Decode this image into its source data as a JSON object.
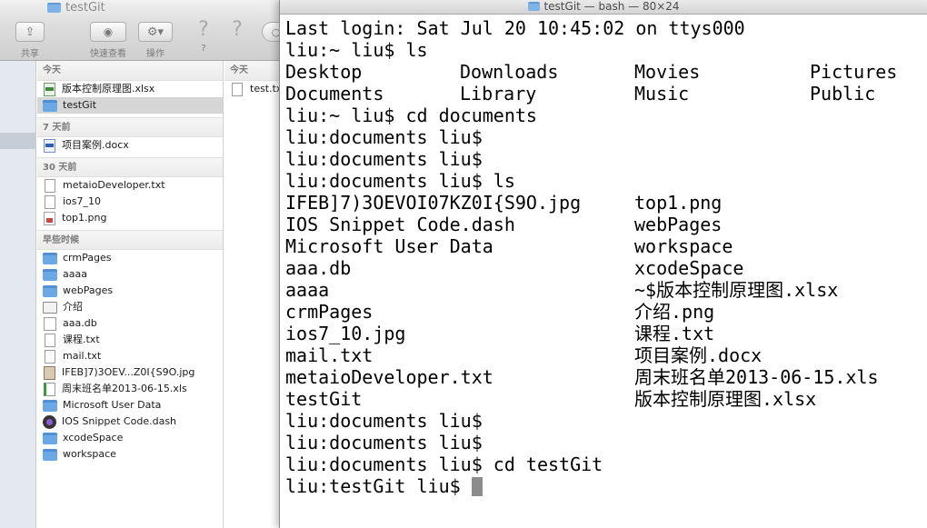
{
  "finder": {
    "title": "testGit",
    "toolbar": {
      "share_label": "共享",
      "quicklook_label": "快速查看",
      "action_label": "操作",
      "help_label": "?"
    },
    "column1": {
      "groups": [
        {
          "header": "今天",
          "items": [
            {
              "name": "版本控制原理图.xlsx",
              "icon": "xlsx-file-icon",
              "selected": false
            },
            {
              "name": "testGit",
              "icon": "folder-icon",
              "selected": true
            }
          ]
        },
        {
          "header": "7 天前",
          "items": [
            {
              "name": "项目案例.docx",
              "icon": "docx-file-icon",
              "selected": false
            }
          ]
        },
        {
          "header": "30 天前",
          "items": [
            {
              "name": "metaioDeveloper.txt",
              "icon": "text-file-icon",
              "selected": false
            },
            {
              "name": "ios7_10",
              "icon": "text-file-icon",
              "selected": false
            },
            {
              "name": "top1.png",
              "icon": "png-file-icon",
              "selected": false
            }
          ]
        },
        {
          "header": "早些时候",
          "items": [
            {
              "name": "crmPages",
              "icon": "folder-icon",
              "selected": false
            },
            {
              "name": "aaaa",
              "icon": "folder-icon",
              "selected": false
            },
            {
              "name": "webPages",
              "icon": "folder-icon",
              "selected": false
            },
            {
              "name": "介绍",
              "icon": "txt-file-icon",
              "selected": false
            },
            {
              "name": "aaa.db",
              "icon": "db-file-icon",
              "selected": false
            },
            {
              "name": "课程.txt",
              "icon": "text-file-icon",
              "selected": false
            },
            {
              "name": "mail.txt",
              "icon": "text-file-icon",
              "selected": false
            },
            {
              "name": "IFEB]7)3OEV...Z0I{S9O.jpg",
              "icon": "jpg-file-icon",
              "selected": false
            },
            {
              "name": "周末班名单2013-06-15.xls",
              "icon": "xls-file-icon",
              "selected": false
            },
            {
              "name": "Microsoft User Data",
              "icon": "folder-icon",
              "selected": false
            },
            {
              "name": "IOS Snippet Code.dash",
              "icon": "dash-file-icon",
              "selected": false
            },
            {
              "name": "xcodeSpace",
              "icon": "folder-icon",
              "selected": false
            },
            {
              "name": "workspace",
              "icon": "folder-icon",
              "selected": false
            }
          ]
        }
      ]
    },
    "column2": {
      "header": "今天",
      "items": [
        {
          "name": "test.txt",
          "icon": "text-file-icon"
        }
      ]
    }
  },
  "terminal": {
    "title": "testGit — bash — 80×24",
    "lines": [
      [
        "Last login: Sat Jul 20 10:45:02 on ttys000"
      ],
      [
        "liu:~ liu$ ls"
      ],
      [
        "Desktop",
        "Downloads",
        "Movies",
        "Pictures"
      ],
      [
        "Documents",
        "Library",
        "Music",
        "Public"
      ],
      [
        "liu:~ liu$ cd documents"
      ],
      [
        "liu:documents liu$"
      ],
      [
        "liu:documents liu$"
      ],
      [
        "liu:documents liu$ ls"
      ],
      [
        "IFEB]7)3OEVOI07KZ0I{S9O.jpg",
        "top1.png"
      ],
      [
        "IOS Snippet Code.dash",
        "webPages"
      ],
      [
        "Microsoft User Data",
        "workspace"
      ],
      [
        "aaa.db",
        "xcodeSpace"
      ],
      [
        "aaaa",
        "~$版本控制原理图.xlsx"
      ],
      [
        "crmPages",
        "介绍.png"
      ],
      [
        "ios7_10.jpg",
        "课程.txt"
      ],
      [
        "mail.txt",
        "项目案例.docx"
      ],
      [
        "metaioDeveloper.txt",
        "周末班名单2013-06-15.xls"
      ],
      [
        "testGit",
        "版本控制原理图.xlsx"
      ],
      [
        "liu:documents liu$"
      ],
      [
        "liu:documents liu$"
      ],
      [
        "liu:documents liu$ cd testGit"
      ],
      [
        "liu:testGit liu$"
      ]
    ]
  }
}
